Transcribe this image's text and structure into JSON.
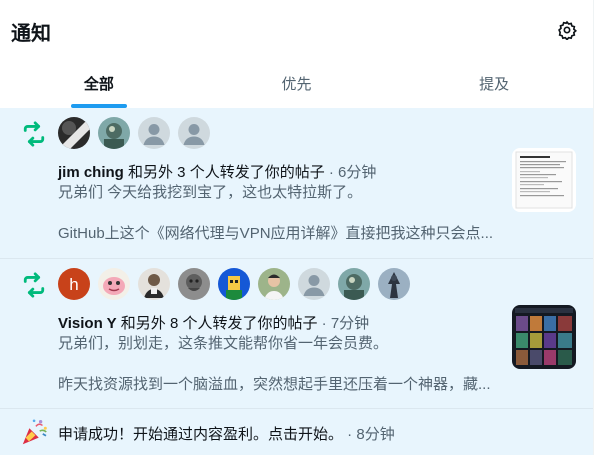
{
  "header": {
    "title": "通知"
  },
  "tabs": [
    {
      "label": "全部",
      "active": true
    },
    {
      "label": "优先",
      "active": false
    },
    {
      "label": "提及",
      "active": false
    }
  ],
  "notifications": [
    {
      "type": "repost",
      "actor": "jim ching",
      "summary": " 和另外 3 个人转发了你的帖子",
      "time": " · 6分钟",
      "preview_line1": "兄弟们 今天给我挖到宝了，这也太特拉斯了。",
      "preview_line2": "GitHub上这个《网络代理与VPN应用详解》直接把我这种只会点...",
      "avatar_count": 4
    },
    {
      "type": "repost",
      "actor": "Vision Y",
      "summary": " 和另外 8 个人转发了你的帖子",
      "time": " · 7分钟",
      "preview_line1": "兄弟们，别划走，这条推文能帮你省一年会员费。",
      "preview_line2": "昨天找资源找到一个脑溢血，突然想起手里还压着一个神器，藏...",
      "avatar_count": 9
    },
    {
      "type": "system",
      "message": "申请成功！开始通过内容盈利。点击开始。",
      "time": " · 8分钟"
    }
  ],
  "colors": {
    "accent": "#1d9bf0",
    "repost": "#00ba7c",
    "feed_bg": "#e8f5fd"
  }
}
